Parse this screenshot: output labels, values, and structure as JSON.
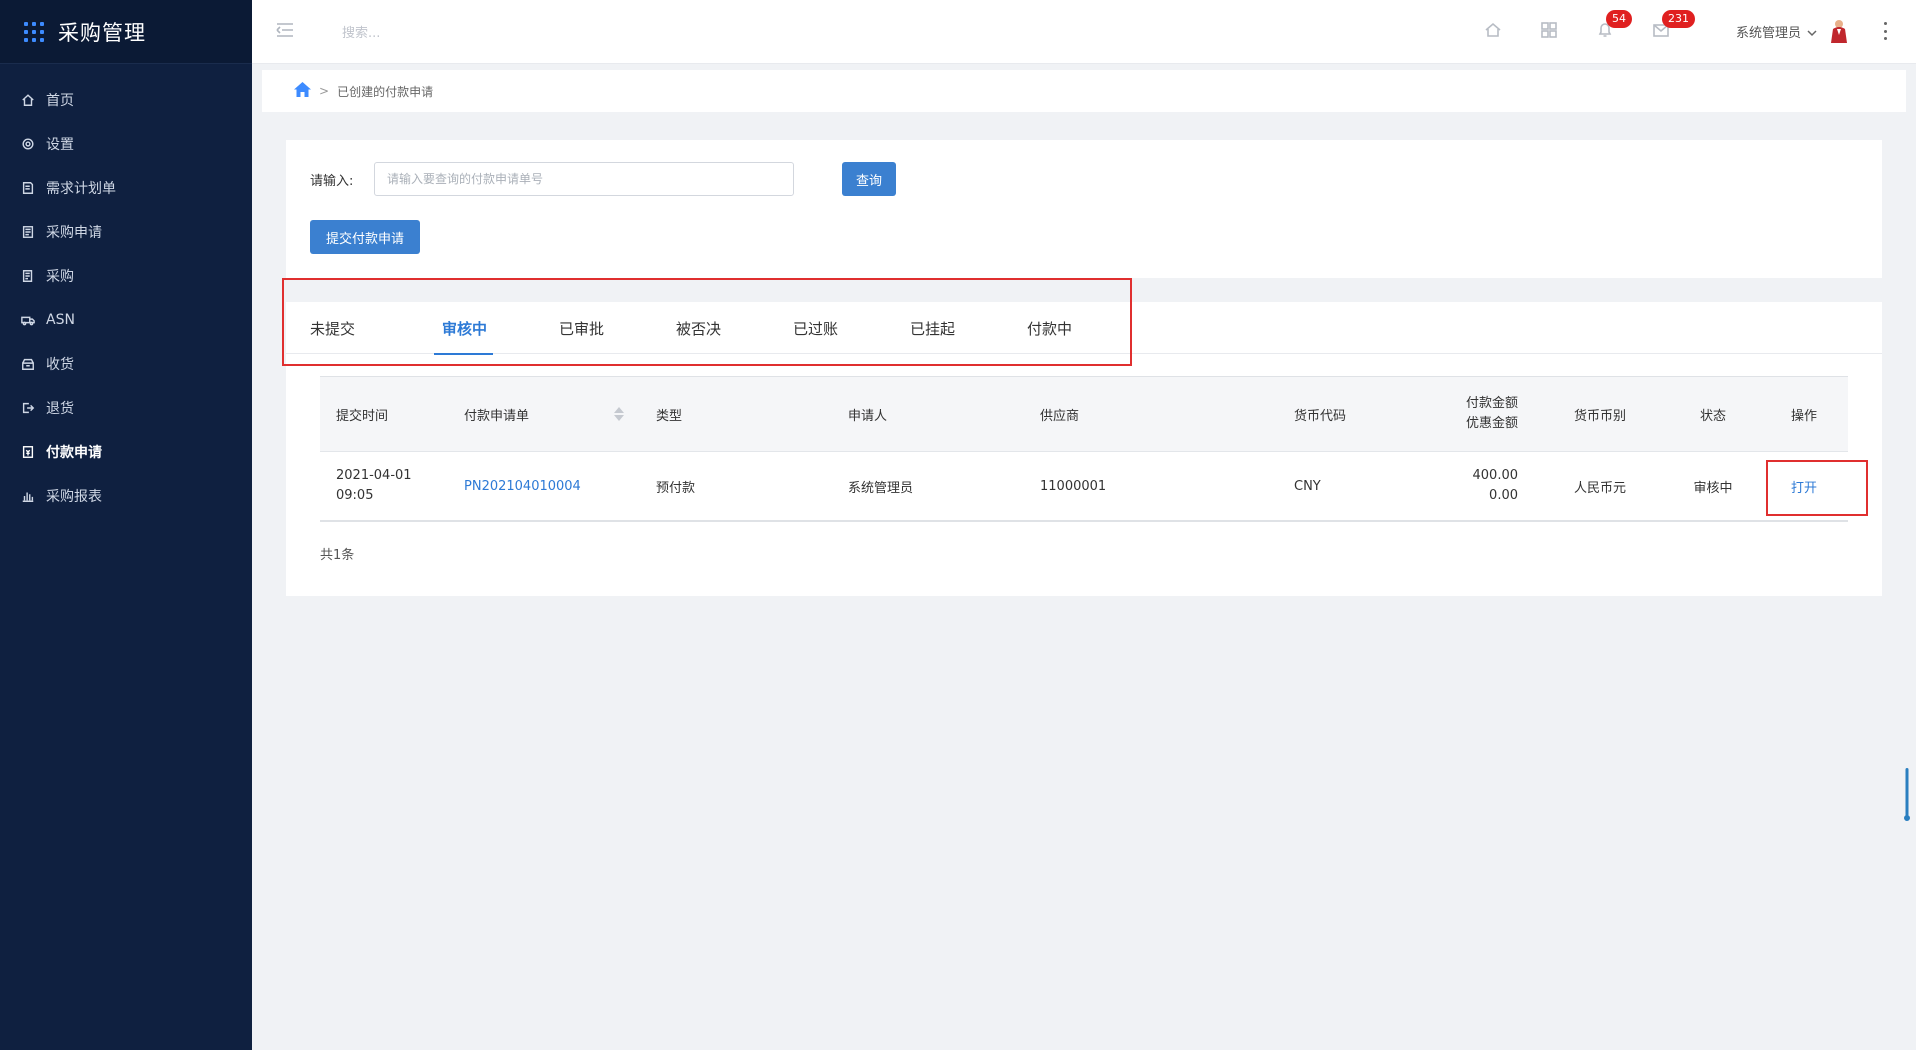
{
  "app": {
    "title": "采购管理"
  },
  "sidebar": {
    "items": [
      {
        "label": "首页",
        "icon": "home-icon"
      },
      {
        "label": "设置",
        "icon": "gear-icon"
      },
      {
        "label": "需求计划单",
        "icon": "document-icon"
      },
      {
        "label": "采购申请",
        "icon": "file-icon"
      },
      {
        "label": "采购",
        "icon": "list-icon"
      },
      {
        "label": "ASN",
        "icon": "truck-icon"
      },
      {
        "label": "收货",
        "icon": "inbox-icon"
      },
      {
        "label": "退货",
        "icon": "exit-icon"
      },
      {
        "label": "付款申请",
        "icon": "payment-icon",
        "active": true
      },
      {
        "label": "采购报表",
        "icon": "bar-chart-icon"
      }
    ]
  },
  "header": {
    "search_placeholder": "搜索...",
    "notifications_count": "54",
    "messages_count": "231",
    "user_name": "系统管理员"
  },
  "breadcrumb": {
    "separator": ">",
    "current": "已创建的付款申请"
  },
  "query": {
    "label": "请输入:",
    "placeholder": "请输入要查询的付款申请单号",
    "value": "",
    "query_button": "查询",
    "submit_button": "提交付款申请"
  },
  "tabs": [
    {
      "label": "未提交"
    },
    {
      "label": "审核中",
      "active": true
    },
    {
      "label": "已审批"
    },
    {
      "label": "被否决"
    },
    {
      "label": "已过账"
    },
    {
      "label": "已挂起"
    },
    {
      "label": "付款中"
    }
  ],
  "table": {
    "columns": {
      "time": "提交时间",
      "no": "付款申请单",
      "type": "类型",
      "applicant": "申请人",
      "supplier": "供应商",
      "currency_code": "货币代码",
      "amount_line1": "付款金额",
      "amount_line2": "优惠金额",
      "currency_name": "货币币别",
      "status": "状态",
      "action": "操作"
    },
    "rows": [
      {
        "date": "2021-04-01",
        "time": "09:05",
        "no": "PN202104010004",
        "type": "预付款",
        "applicant": "系统管理员",
        "supplier": "11000001",
        "currency_code": "CNY",
        "amount": "400.00",
        "discount": "0.00",
        "currency_name": "人民币元",
        "status": "审核中",
        "action": "打开"
      }
    ],
    "total": "共1条"
  },
  "colors": {
    "sidebar_bg": "#0f2040",
    "accent": "#2d7ad6",
    "button": "#3b80d0",
    "badge": "#e02020",
    "highlight": "#e02f2f"
  }
}
